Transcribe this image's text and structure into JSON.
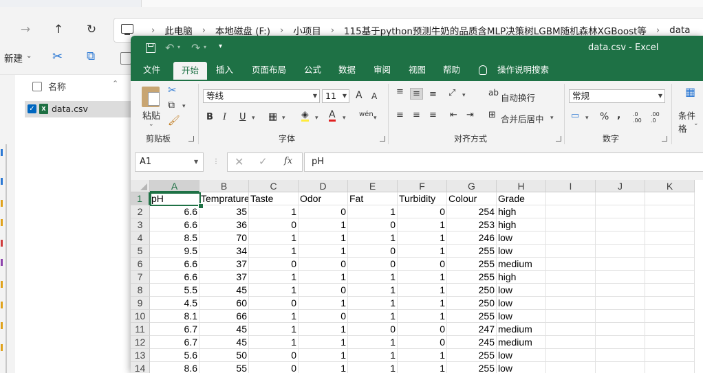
{
  "explorer": {
    "breadcrumbs": [
      "此电脑",
      "本地磁盘 (F:)",
      "小项目",
      "115基于python预测牛奶的品质含MLP决策树LGBM随机森林XGBoost等",
      "data"
    ],
    "new_label": "新建",
    "column_name": "名称",
    "file_name": "data.csv"
  },
  "excel": {
    "window_title": "data.csv  -  Excel",
    "tabs": [
      "文件",
      "开始",
      "插入",
      "页面布局",
      "公式",
      "数据",
      "审阅",
      "视图",
      "帮助"
    ],
    "active_tab": "开始",
    "search_label": "操作说明搜索",
    "ribbon": {
      "clipboard": {
        "paste_label": "粘贴",
        "group_label": "剪贴板"
      },
      "font": {
        "font_name": "等线",
        "font_size": "11",
        "grow": "A",
        "shrink": "A",
        "bold": "B",
        "italic": "I",
        "underline": "U",
        "font_color_glyph": "A",
        "phonetic": "wén",
        "group_label": "字体"
      },
      "alignment": {
        "wrap_text": "自动换行",
        "merge_center": "合并后居中",
        "group_label": "对齐方式"
      },
      "number": {
        "format": "常规",
        "percent": "%",
        "comma": ",",
        "inc_dec": ".0 .00",
        "dec_dec": ".00 .0",
        "group_label": "数字"
      },
      "styles": {
        "conditional_label": "条件格"
      }
    },
    "name_box": "A1",
    "fx_label": "fx",
    "formula_content": "pH",
    "sheet": {
      "columns": [
        "A",
        "B",
        "C",
        "D",
        "E",
        "F",
        "G",
        "H",
        "I",
        "J",
        "K"
      ],
      "row_numbers": [
        "1",
        "2",
        "3",
        "4",
        "5",
        "6",
        "7",
        "8",
        "9",
        "10",
        "11",
        "12",
        "13",
        "14"
      ],
      "header": [
        "pH",
        "Temprature",
        "Taste",
        "Odor",
        "Fat",
        "Turbidity",
        "Colour",
        "Grade"
      ],
      "rows": [
        [
          "6.6",
          "35",
          "1",
          "0",
          "1",
          "0",
          "254",
          "high"
        ],
        [
          "6.6",
          "36",
          "0",
          "1",
          "0",
          "1",
          "253",
          "high"
        ],
        [
          "8.5",
          "70",
          "1",
          "1",
          "1",
          "1",
          "246",
          "low"
        ],
        [
          "9.5",
          "34",
          "1",
          "1",
          "0",
          "1",
          "255",
          "low"
        ],
        [
          "6.6",
          "37",
          "0",
          "0",
          "0",
          "0",
          "255",
          "medium"
        ],
        [
          "6.6",
          "37",
          "1",
          "1",
          "1",
          "1",
          "255",
          "high"
        ],
        [
          "5.5",
          "45",
          "1",
          "0",
          "1",
          "1",
          "250",
          "low"
        ],
        [
          "4.5",
          "60",
          "0",
          "1",
          "1",
          "1",
          "250",
          "low"
        ],
        [
          "8.1",
          "66",
          "1",
          "0",
          "1",
          "1",
          "255",
          "low"
        ],
        [
          "6.7",
          "45",
          "1",
          "1",
          "0",
          "0",
          "247",
          "medium"
        ],
        [
          "6.7",
          "45",
          "1",
          "1",
          "1",
          "0",
          "245",
          "medium"
        ],
        [
          "5.6",
          "50",
          "0",
          "1",
          "1",
          "1",
          "255",
          "low"
        ],
        [
          "8.6",
          "55",
          "0",
          "1",
          "1",
          "1",
          "255",
          "low"
        ]
      ]
    }
  },
  "colors": {
    "excel_green": "#1e7145",
    "windows_blue": "#0067c0"
  }
}
